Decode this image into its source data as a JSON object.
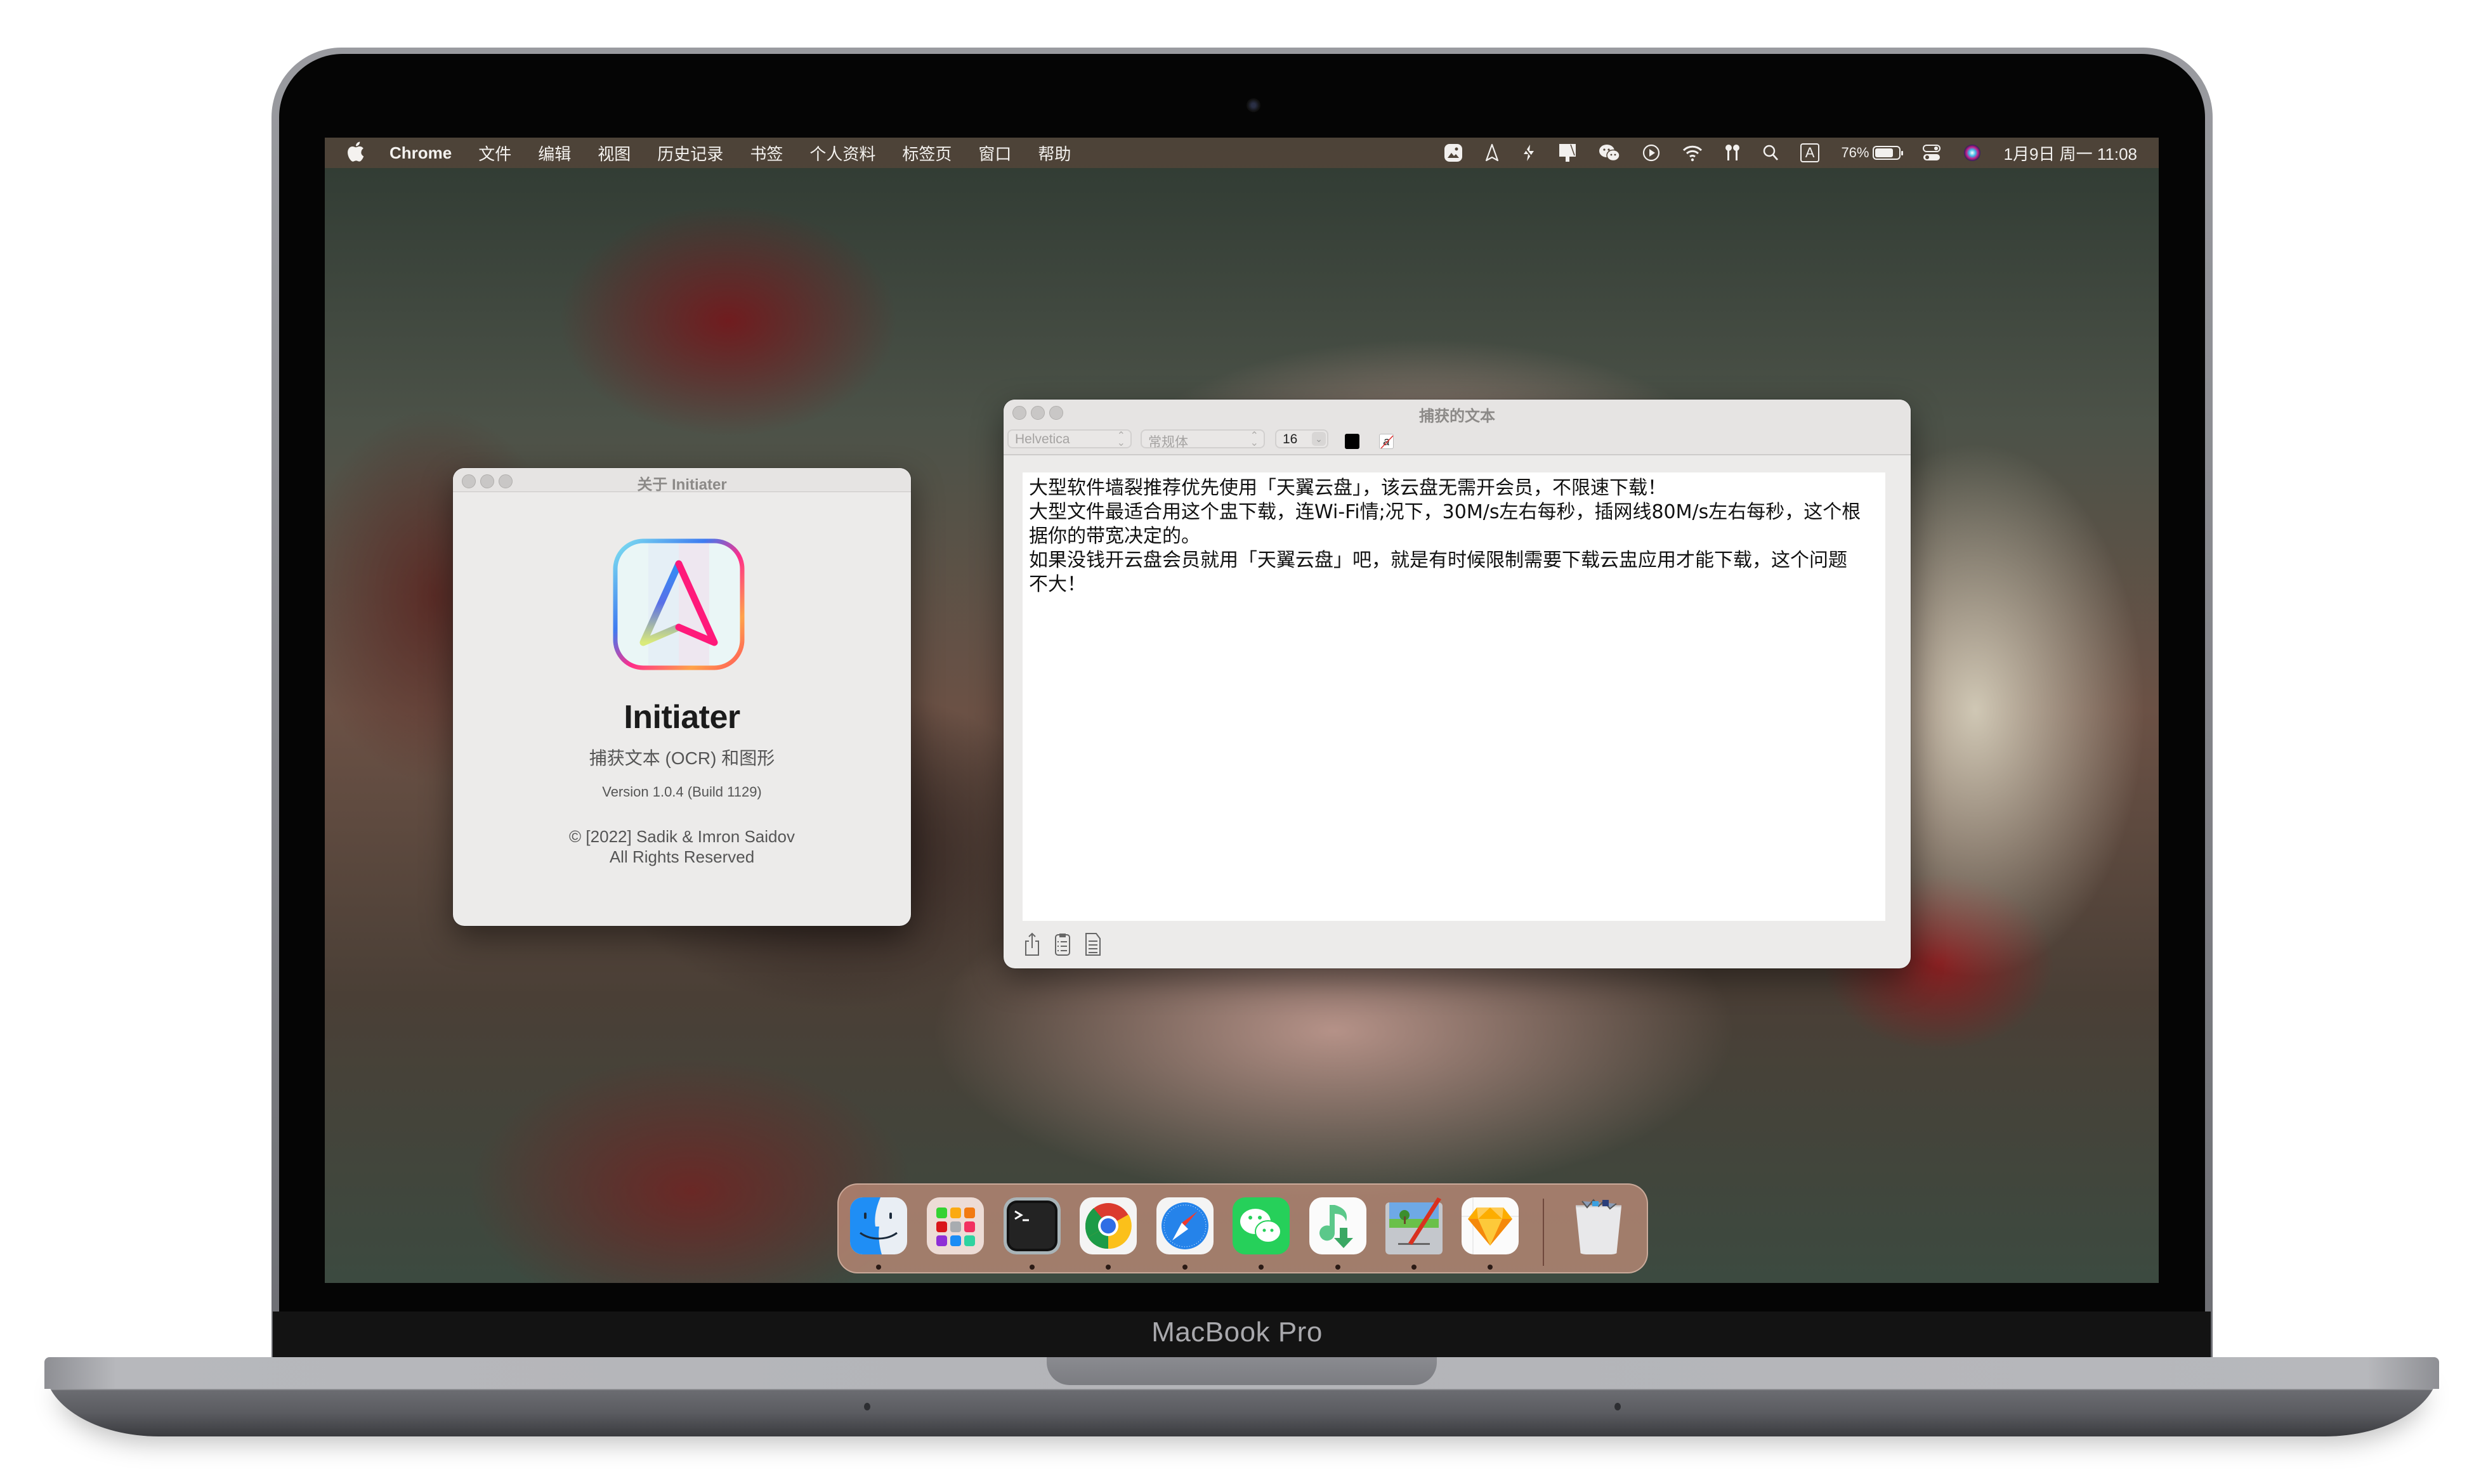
{
  "device": {
    "brand_label": "MacBook Pro"
  },
  "menubar": {
    "apple_icon": "apple-logo-icon",
    "app_name": "Chrome",
    "items": [
      "文件",
      "编辑",
      "视图",
      "历史记录",
      "书签",
      "个人资料",
      "标签页",
      "窗口",
      "帮助"
    ],
    "status_icons": [
      "image-capture-icon",
      "navigation-arrow-icon",
      "bolt-slash-icon",
      "notch-app-icon",
      "wechat-icon",
      "play-circle-icon",
      "wifi-icon",
      "airpods-icon",
      "spotlight-search-icon",
      "input-source-icon",
      "battery-icon",
      "control-center-icon",
      "siri-icon"
    ],
    "input_source_label": "A",
    "battery_percent": "76%",
    "battery_level": 0.76,
    "datetime": "1月9日 周一  11:08"
  },
  "about_window": {
    "title": "关于 Initiater",
    "app_name": "Initiater",
    "subtitle": "捕获文本 (OCR) 和图形",
    "version": "Version 1.0.4 (Build 1129)",
    "copyright": "© [2022] Sadik & Imron Saidov",
    "rights": "All Rights Reserved"
  },
  "text_window": {
    "title": "捕获的文本",
    "toolbar": {
      "font_family": "Helvetica",
      "font_style": "常规体",
      "font_size": "16",
      "text_color": "#000000",
      "highlight_label": "a"
    },
    "content_lines": [
      "大型软件墙裂推荐优先使用「天翼云盘」，该云盘无需开会员，不限速下载！",
      "大型文件最适合用这个盅下载，连Wi-Fi情;况下，30M/s左右每秒，插网线80M/s左右每秒，这个根",
      "据你的带宽决定的。",
      "如果没钱开云盘会员就用「天翼云盘」吧，就是有时候限制需要下载云盅应用才能下载，这个问题",
      "不大！"
    ],
    "bottom_icons": [
      "share-icon",
      "clipboard-icon",
      "document-icon"
    ]
  },
  "dock": {
    "apps": [
      {
        "name": "Finder",
        "icon": "finder-icon",
        "running": true
      },
      {
        "name": "Launchpad",
        "icon": "launchpad-icon",
        "running": false
      },
      {
        "name": "Terminal",
        "icon": "terminal-icon",
        "running": true
      },
      {
        "name": "Google Chrome",
        "icon": "chrome-icon",
        "running": true
      },
      {
        "name": "Safari",
        "icon": "safari-icon",
        "running": true
      },
      {
        "name": "WeChat",
        "icon": "wechat-icon",
        "running": true
      },
      {
        "name": "Music Downloader",
        "icon": "music-download-icon",
        "running": true
      },
      {
        "name": "Paintbrush",
        "icon": "paintbrush-icon",
        "running": true
      },
      {
        "name": "Sketch",
        "icon": "sketch-icon",
        "running": true
      }
    ],
    "trash": {
      "name": "Trash",
      "icon": "trash-icon"
    }
  }
}
